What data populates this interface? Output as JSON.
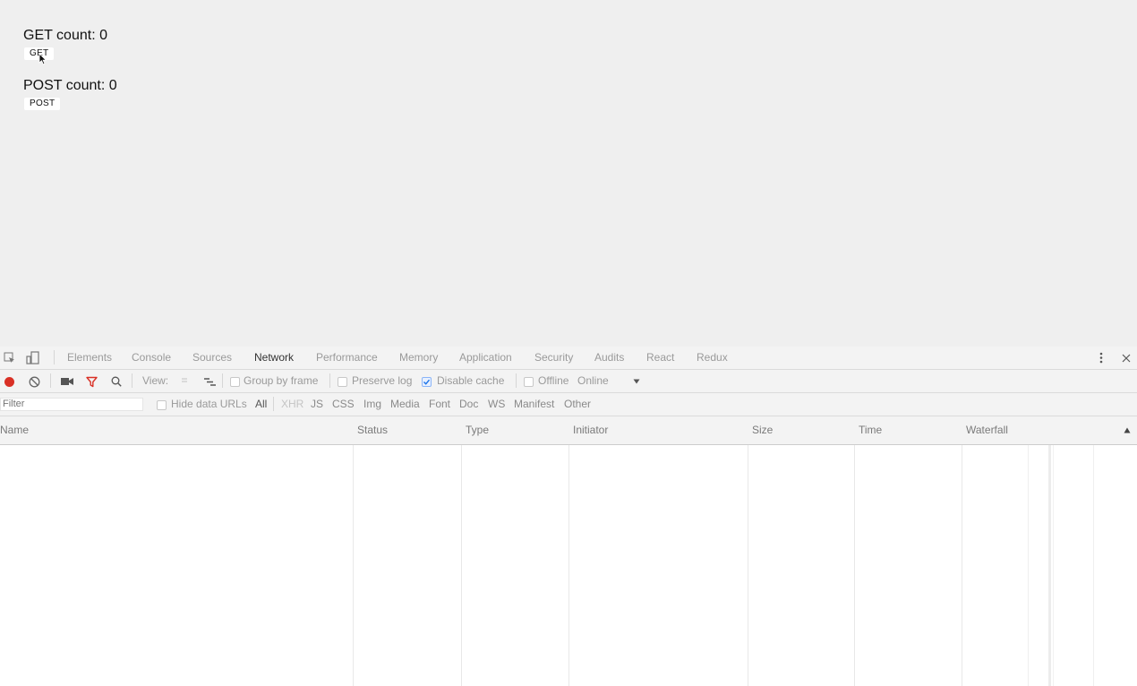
{
  "page": {
    "get_counter": "GET count: 0",
    "get_button": "GET",
    "post_counter": "POST count: 0",
    "post_button": "POST"
  },
  "devtools": {
    "tabs": [
      "Elements",
      "Console",
      "Sources",
      "Network",
      "Performance",
      "Memory",
      "Application",
      "Security",
      "Audits",
      "React",
      "Redux"
    ],
    "active_tab": "Network",
    "toolbar": {
      "view_label": "View:",
      "group_by_frame": "Group by frame",
      "preserve_log": "Preserve log",
      "disable_cache": "Disable cache",
      "disable_cache_checked": true,
      "offline": "Offline",
      "throttle_value": "Online"
    },
    "filter": {
      "placeholder": "Filter",
      "hide_data_urls": "Hide data URLs",
      "types": [
        "All",
        "XHR",
        "JS",
        "CSS",
        "Img",
        "Media",
        "Font",
        "Doc",
        "WS",
        "Manifest",
        "Other"
      ]
    },
    "columns": [
      "Name",
      "Status",
      "Type",
      "Initiator",
      "Size",
      "Time",
      "Waterfall"
    ],
    "record_color": "#d93025",
    "filter_icon_color": "#d93025"
  }
}
